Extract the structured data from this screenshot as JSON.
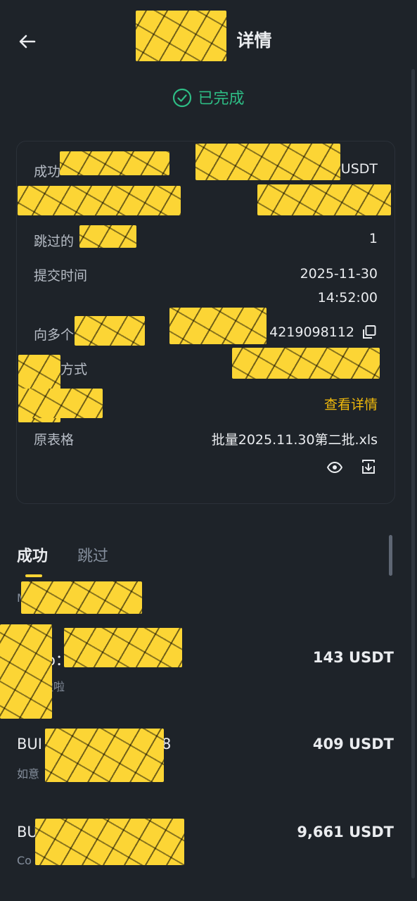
{
  "header": {
    "title": "详情"
  },
  "status": {
    "text": "已完成",
    "color": "#2ebd85"
  },
  "details": {
    "success_label": "成功",
    "success_value_suffix": "USDT",
    "skipped_label": "跳过的",
    "skipped_value": "1",
    "submit_time_label": "提交时间",
    "submit_date": "2025-11-30",
    "submit_clock": "14:52:00",
    "multi_label": "向多个",
    "multi_value": "4219098112",
    "method_label": "方式",
    "view_details": "查看详情",
    "sheet_label": "原表格",
    "sheet_name": "批量2025.11.30第二批.xls"
  },
  "tabs": [
    {
      "label": "成功",
      "active": true
    },
    {
      "label": "跳过",
      "active": false
    }
  ],
  "list_header": "M",
  "rows": [
    {
      "name": "o：",
      "sub": "盈啦",
      "amount": "143 USDT"
    },
    {
      "name": "BUI",
      "name_tail": "8",
      "sub": "如意",
      "amount": "409 USDT"
    },
    {
      "name": "BU",
      "sub": "Co",
      "amount": "9,661 USDT"
    }
  ],
  "colors": {
    "accent": "#fcd535",
    "link": "#f0b90b",
    "background": "#1e2329"
  },
  "icons": [
    "back-arrow-icon",
    "check-circle-icon",
    "copy-icon",
    "eye-icon",
    "download-icon"
  ]
}
